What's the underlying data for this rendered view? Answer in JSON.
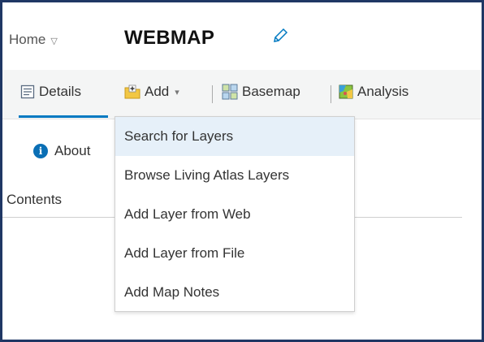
{
  "header": {
    "home_label": "Home",
    "home_caret": "▽",
    "map_title": "WEBMAP"
  },
  "toolbar": {
    "details_label": "Details",
    "add_label": "Add",
    "add_caret": "▾",
    "basemap_label": "Basemap",
    "analysis_label": "Analysis"
  },
  "side": {
    "about_label": "About",
    "info_glyph": "i",
    "contents_label": "Contents"
  },
  "add_menu": {
    "items": [
      {
        "label": "Search for Layers",
        "active": true
      },
      {
        "label": "Browse Living Atlas Layers",
        "active": false
      },
      {
        "label": "Add Layer from Web",
        "active": false
      },
      {
        "label": "Add Layer from File",
        "active": false
      },
      {
        "label": "Add Map Notes",
        "active": false
      }
    ]
  },
  "colors": {
    "frame": "#1f3764",
    "accent": "#0079c1",
    "menu_highlight": "#e6f0f9"
  },
  "icons": {
    "edit": "pencil-icon",
    "details": "details-icon",
    "add": "add-layer-icon",
    "basemap": "basemap-grid-icon",
    "analysis": "analysis-icon",
    "about": "info-icon"
  }
}
